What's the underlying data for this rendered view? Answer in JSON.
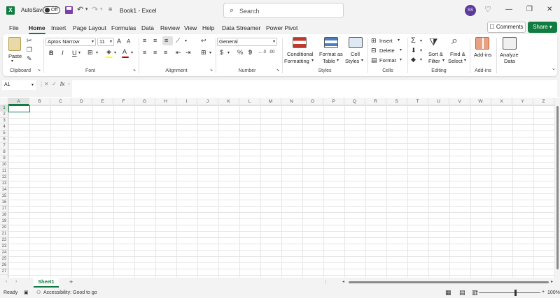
{
  "titlebar": {
    "autosave": "AutoSave",
    "toggle": "Off",
    "doc_title": "Book1  -  Excel",
    "search_placeholder": "Search",
    "avatar": "SS"
  },
  "menu": {
    "tabs": [
      "File",
      "Home",
      "Insert",
      "Page Layout",
      "Formulas",
      "Data",
      "Review",
      "View",
      "Help",
      "Data Streamer",
      "Power Pivot"
    ],
    "comments": "Comments",
    "share": "Share"
  },
  "ribbon": {
    "groups": [
      "Clipboard",
      "Font",
      "Alignment",
      "Number",
      "Styles",
      "Cells",
      "Editing",
      "Add-ins"
    ],
    "paste": "Paste",
    "font_name": "Aptos Narrow",
    "font_size": "11",
    "number_format": "General",
    "cond_fmt": [
      "Conditional",
      "Formatting"
    ],
    "format_table": [
      "Format as",
      "Table"
    ],
    "cell_styles": [
      "Cell",
      "Styles"
    ],
    "insert": "Insert",
    "delete": "Delete",
    "format": "Format",
    "sort_filter": [
      "Sort &",
      "Filter"
    ],
    "find_select": [
      "Find &",
      "Select"
    ],
    "addins": "Add-ins",
    "analyze": [
      "Analyze",
      "Data"
    ],
    "bold": "B",
    "italic": "I",
    "underline": "U",
    "font_color_letter": "A",
    "grow": "A",
    "shrink": "A",
    "currency": "$",
    "percent": "%",
    "comma": "9",
    "inc_dec": "←.0",
    "dec_dec": ".00"
  },
  "formula": {
    "namebox": "A1",
    "fx": "fx"
  },
  "grid": {
    "columns": [
      "A",
      "B",
      "C",
      "D",
      "E",
      "F",
      "G",
      "H",
      "I",
      "J",
      "K",
      "L",
      "M",
      "N",
      "O",
      "P",
      "Q",
      "R",
      "S",
      "T",
      "U",
      "V",
      "W",
      "X",
      "Y",
      "Z"
    ],
    "rows": [
      "1",
      "2",
      "3",
      "4",
      "5",
      "6",
      "7",
      "8",
      "9",
      "10",
      "11",
      "12",
      "13",
      "14",
      "15",
      "16",
      "17",
      "18",
      "19",
      "20",
      "21",
      "22",
      "23",
      "24",
      "25",
      "26",
      "27"
    ]
  },
  "sheets": {
    "active": "Sheet1",
    "add": "+"
  },
  "status": {
    "ready": "Ready",
    "accessibility": "Accessibility: Good to go",
    "zoom": "100%"
  },
  "colors": {
    "accent": "#107c41",
    "font_color": "#c00000",
    "highlight": "#ffff00"
  }
}
